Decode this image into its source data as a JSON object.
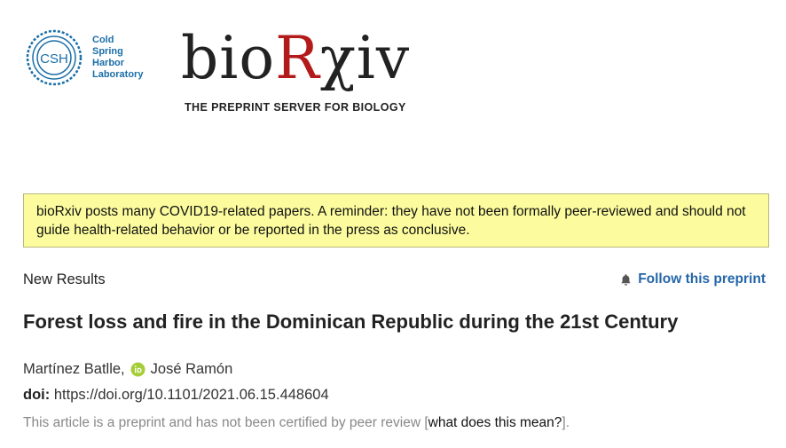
{
  "header": {
    "csh_logo": {
      "monogram": "CSH",
      "lines": [
        "Cold",
        "Spring",
        "Harbor",
        "Laboratory"
      ],
      "color": "#1a6ea8"
    },
    "biorxiv_logo": {
      "wordmark_prefix": "bio",
      "wordmark_r": "R",
      "wordmark_suffix": "χiv",
      "tagline": "THE PREPRINT SERVER FOR BIOLOGY",
      "accent_color": "#b31b1b"
    }
  },
  "banner": {
    "text": "bioRxiv posts many COVID19-related papers. A reminder: they have not been formally peer-reviewed and should not guide health-related behavior or be reported in the press as conclusive.",
    "background": "#fcfc9e"
  },
  "article": {
    "category": "New Results",
    "follow_label": "Follow this preprint",
    "follow_icon": "bell-icon",
    "title": "Forest loss and fire in the Dominican Republic during the 21st Century",
    "author_first": "Martínez Batlle,",
    "author_second": "José Ramón",
    "orcid_icon": "orcid-icon",
    "doi_label": "doi:",
    "doi_value": "https://doi.org/10.1101/2021.06.15.448604",
    "disclaimer_prefix": "This article is a preprint and has not been certified by peer review [",
    "disclaimer_link": "what does this mean?",
    "disclaimer_suffix": "]."
  }
}
